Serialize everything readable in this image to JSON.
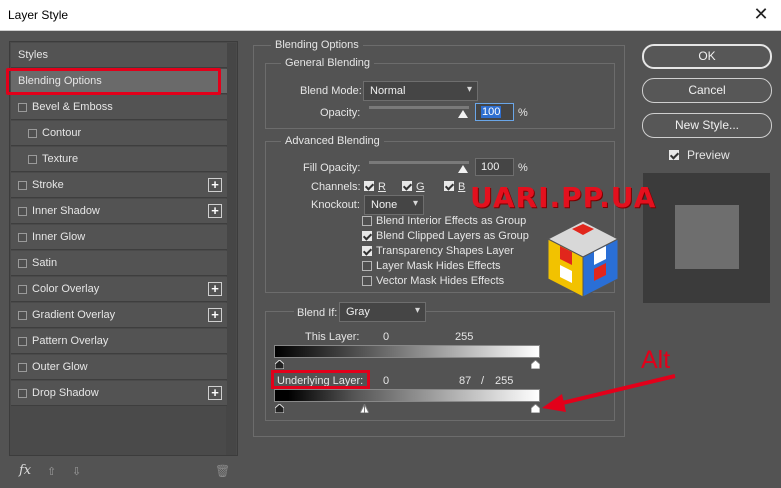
{
  "window": {
    "title": "Layer Style",
    "close_glyph": "✕"
  },
  "styles_list": [
    {
      "label": "Styles",
      "kind": "header",
      "checkbox": false,
      "plus": false
    },
    {
      "label": "Blending Options",
      "kind": "selected",
      "checkbox": false,
      "plus": false
    },
    {
      "label": "Bevel & Emboss",
      "kind": "item",
      "checkbox": true,
      "plus": false
    },
    {
      "label": "Contour",
      "kind": "sub",
      "checkbox": true,
      "plus": false
    },
    {
      "label": "Texture",
      "kind": "sub",
      "checkbox": true,
      "plus": false
    },
    {
      "label": "Stroke",
      "kind": "item",
      "checkbox": true,
      "plus": true
    },
    {
      "label": "Inner Shadow",
      "kind": "item",
      "checkbox": true,
      "plus": true
    },
    {
      "label": "Inner Glow",
      "kind": "item",
      "checkbox": true,
      "plus": false
    },
    {
      "label": "Satin",
      "kind": "item",
      "checkbox": true,
      "plus": false
    },
    {
      "label": "Color Overlay",
      "kind": "item",
      "checkbox": true,
      "plus": true
    },
    {
      "label": "Gradient Overlay",
      "kind": "item",
      "checkbox": true,
      "plus": true
    },
    {
      "label": "Pattern Overlay",
      "kind": "item",
      "checkbox": true,
      "plus": false
    },
    {
      "label": "Outer Glow",
      "kind": "item",
      "checkbox": true,
      "plus": false
    },
    {
      "label": "Drop Shadow",
      "kind": "item",
      "checkbox": true,
      "plus": true
    }
  ],
  "footer": {
    "fx": "fx",
    "up": "⇧",
    "down": "⇩",
    "trash": "🗑"
  },
  "blending_options": {
    "title": "Blending Options",
    "general": {
      "title": "General Blending",
      "blend_mode_label": "Blend Mode:",
      "blend_mode_value": "Normal",
      "opacity_label": "Opacity:",
      "opacity_value": "100",
      "percent": "%"
    },
    "advanced": {
      "title": "Advanced Blending",
      "fill_opacity_label": "Fill Opacity:",
      "fill_opacity_value": "100",
      "percent": "%",
      "channels_label": "Channels:",
      "channel_r": "R",
      "channel_g": "G",
      "channel_b": "B",
      "knockout_label": "Knockout:",
      "knockout_value": "None",
      "options": [
        {
          "label": "Blend Interior Effects as Group",
          "checked": false
        },
        {
          "label": "Blend Clipped Layers as Group",
          "checked": true
        },
        {
          "label": "Transparency Shapes Layer",
          "checked": true
        },
        {
          "label": "Layer Mask Hides Effects",
          "checked": false
        },
        {
          "label": "Vector Mask Hides Effects",
          "checked": false
        }
      ]
    },
    "blend_if": {
      "label": "Blend If:",
      "value": "Gray",
      "this_layer_label": "This Layer:",
      "this_layer_low": "0",
      "this_layer_high": "255",
      "underlying_label": "Underlying Layer:",
      "underlying_low": "0",
      "underlying_split": "87",
      "slash": "/",
      "underlying_high": "255"
    }
  },
  "buttons": {
    "ok": "OK",
    "cancel": "Cancel",
    "new_style": "New Style...",
    "preview": "Preview"
  },
  "overlays": {
    "watermark": "UARI.PP.UA",
    "annotation": "Alt"
  },
  "colors": {
    "accent_red": "#e2001a",
    "panel_bg": "#535353",
    "selection_blue": "#2f6fd0"
  }
}
